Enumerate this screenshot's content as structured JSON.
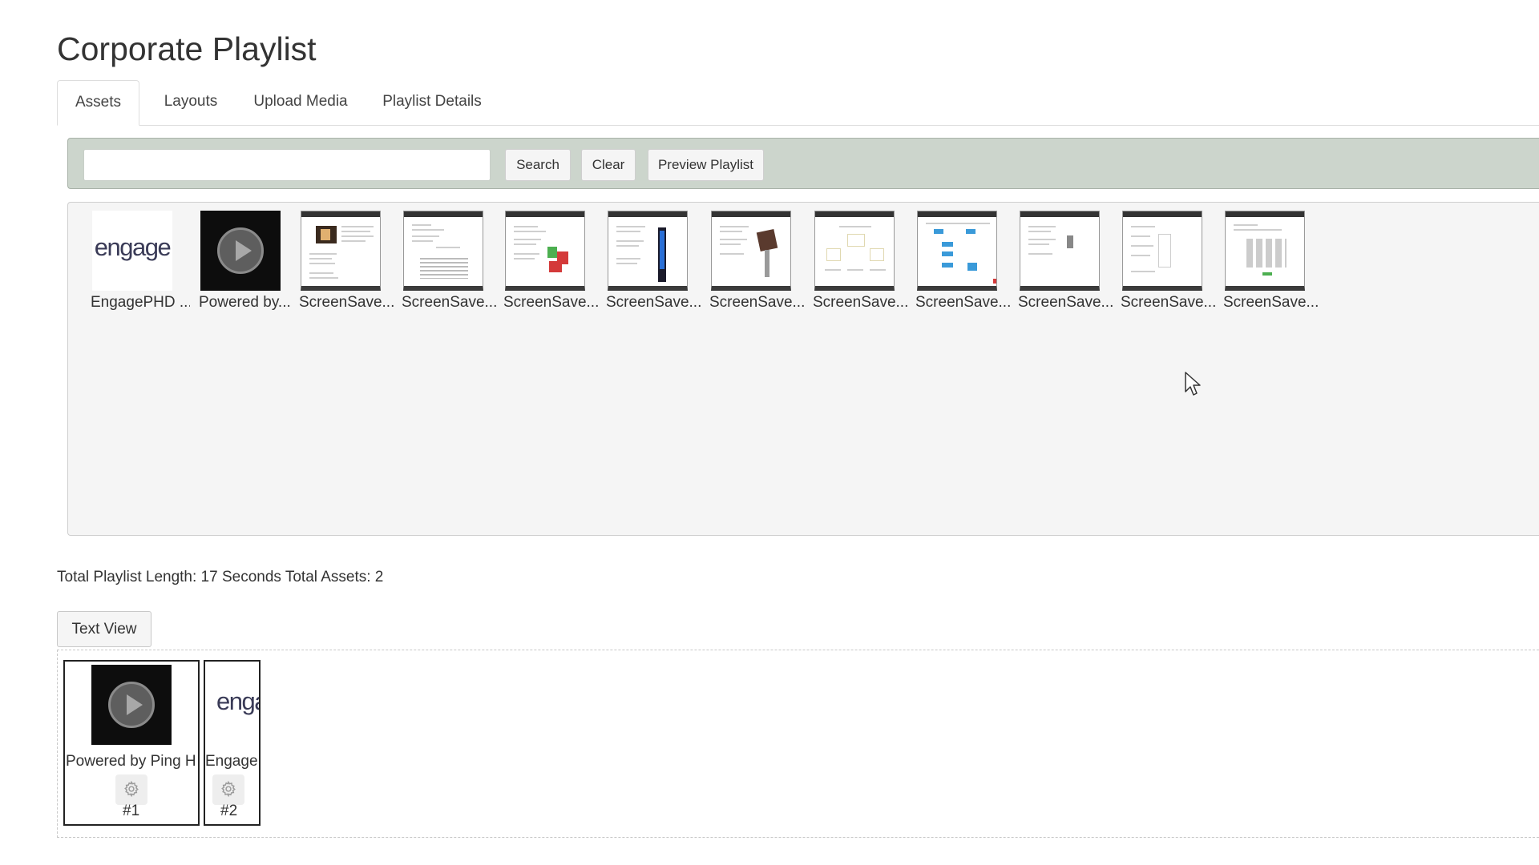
{
  "page": {
    "title": "Corporate Playlist"
  },
  "tabs": [
    {
      "label": "Assets",
      "active": true
    },
    {
      "label": "Layouts",
      "active": false
    },
    {
      "label": "Upload Media",
      "active": false
    },
    {
      "label": "Playlist Details",
      "active": false
    }
  ],
  "toolbar": {
    "search_value": "",
    "search_label": "Search",
    "clear_label": "Clear",
    "preview_label": "Preview Playlist"
  },
  "library": {
    "assets": [
      {
        "caption": "EngagePHD ...",
        "thumb": "engage-logo",
        "logo_text": "engage"
      },
      {
        "caption": "Powered by...",
        "thumb": "video-play-icon"
      },
      {
        "caption": "ScreenSave...",
        "thumb": "document-preview"
      },
      {
        "caption": "ScreenSave...",
        "thumb": "document-preview"
      },
      {
        "caption": "ScreenSave...",
        "thumb": "document-preview"
      },
      {
        "caption": "ScreenSave...",
        "thumb": "document-preview"
      },
      {
        "caption": "ScreenSave...",
        "thumb": "document-preview"
      },
      {
        "caption": "ScreenSave...",
        "thumb": "document-preview"
      },
      {
        "caption": "ScreenSave...",
        "thumb": "document-preview"
      },
      {
        "caption": "ScreenSave...",
        "thumb": "document-preview"
      },
      {
        "caption": "ScreenSave...",
        "thumb": "document-preview"
      },
      {
        "caption": "ScreenSave...",
        "thumb": "document-preview"
      }
    ]
  },
  "summary": {
    "length_label": "Total Playlist Length:",
    "length_value": "17 Seconds",
    "assets_label": "Total Assets:",
    "assets_value": "2"
  },
  "text_view_label": "Text View",
  "playlist": {
    "items": [
      {
        "caption": "Powered by Ping H",
        "number": "#1",
        "thumb": "video-play-icon"
      },
      {
        "caption": "Engage",
        "number": "#2",
        "thumb": "engage-logo",
        "logo_text": "engag"
      }
    ]
  },
  "colors": {
    "toolbar_bg": "#ccd5cc",
    "library_bg": "#f5f5f5",
    "logo_text": "#3a3b57",
    "doc_accent_blue": "#3a9ad9",
    "doc_accent_red": "#d43a3a",
    "doc_accent_green": "#4caf50"
  }
}
